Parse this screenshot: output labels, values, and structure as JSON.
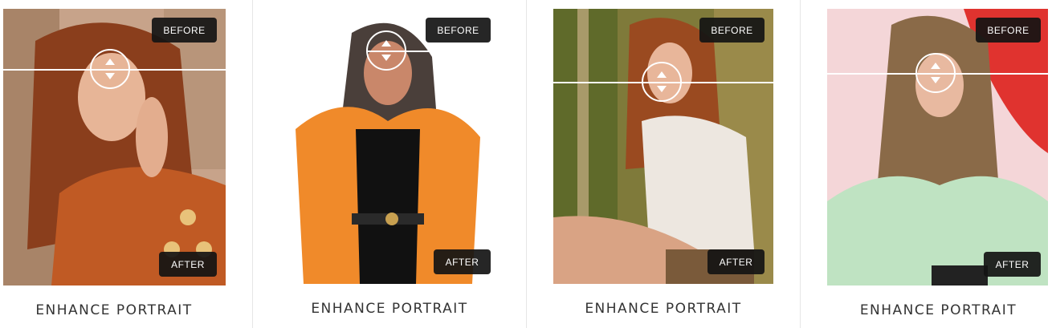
{
  "cards": [
    {
      "before_label": "BEFORE",
      "after_label": "AFTER",
      "caption": "ENHANCE PORTRAIT"
    },
    {
      "before_label": "BEFORE",
      "after_label": "AFTER",
      "caption": "ENHANCE PORTRAIT"
    },
    {
      "before_label": "BEFORE",
      "after_label": "AFTER",
      "caption": "ENHANCE PORTRAIT"
    },
    {
      "before_label": "BEFORE",
      "after_label": "AFTER",
      "caption": "ENHANCE PORTRAIT"
    }
  ]
}
